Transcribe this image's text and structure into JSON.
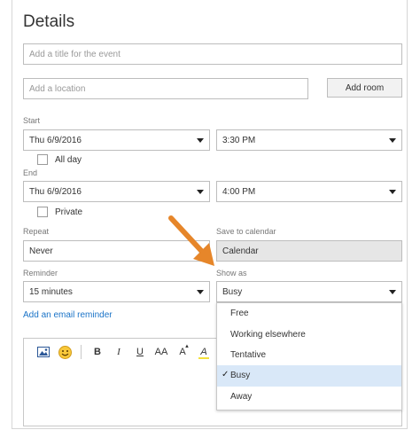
{
  "page_title": "Details",
  "event_title": {
    "placeholder": "Add a title for the event"
  },
  "location": {
    "placeholder": "Add a location",
    "add_room_label": "Add room"
  },
  "start": {
    "label": "Start",
    "date": "Thu 6/9/2016",
    "time": "3:30 PM",
    "all_day_label": "All day"
  },
  "end": {
    "label": "End",
    "date": "Thu 6/9/2016",
    "time": "4:00 PM",
    "private_label": "Private"
  },
  "repeat": {
    "label": "Repeat",
    "value": "Never"
  },
  "save_to": {
    "label": "Save to calendar",
    "value": "Calendar"
  },
  "reminder": {
    "label": "Reminder",
    "value": "15 minutes",
    "add_email_label": "Add an email reminder"
  },
  "show_as": {
    "label": "Show as",
    "value": "Busy",
    "options": [
      "Free",
      "Working elsewhere",
      "Tentative",
      "Busy",
      "Away"
    ],
    "selected": "Busy"
  },
  "toolbar": {
    "bold": "B",
    "italic": "I",
    "underline": "U",
    "font_size_large": "AA",
    "font_size_up": "A",
    "highlight": "A"
  },
  "colors": {
    "arrow": "#e6862a",
    "link": "#1a73c7",
    "selected_bg": "#d9e8f8"
  }
}
